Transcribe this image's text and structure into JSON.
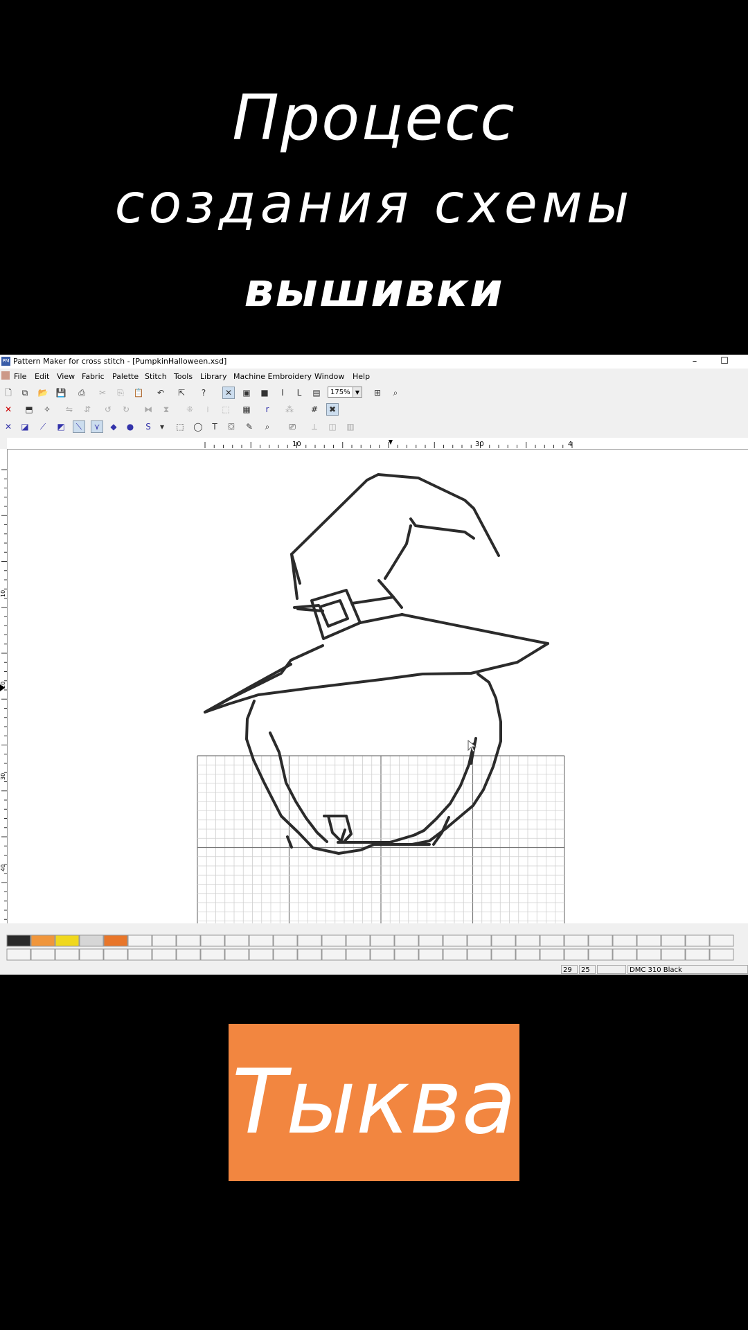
{
  "headline": {
    "line1": "Процесс",
    "line2": "создания схемы",
    "line3": "вышивки"
  },
  "app": {
    "icon_text": "PM",
    "title": "Pattern Maker for cross stitch - [PumpkinHalloween.xsd]",
    "window_controls": {
      "minimize": "–",
      "maximize": "☐"
    },
    "menu": [
      "File",
      "Edit",
      "View",
      "Fabric",
      "Palette",
      "Stitch",
      "Tools",
      "Library",
      "Machine Embroidery",
      "Window",
      "Help"
    ],
    "zoom": "175%",
    "ruler_top_labels": [
      "10",
      "30",
      "4"
    ],
    "ruler_left_labels": [
      "10",
      "20",
      "30",
      "40"
    ],
    "palette_colors": [
      "#2a2a2a",
      "#f0963c",
      "#f0d81e",
      "#d6d6d6",
      "#e8762a"
    ],
    "status": {
      "x": "29",
      "y": "25",
      "thread": "DMC 310 Black"
    }
  },
  "label": {
    "text": "Тыква",
    "color": "#f28640"
  }
}
